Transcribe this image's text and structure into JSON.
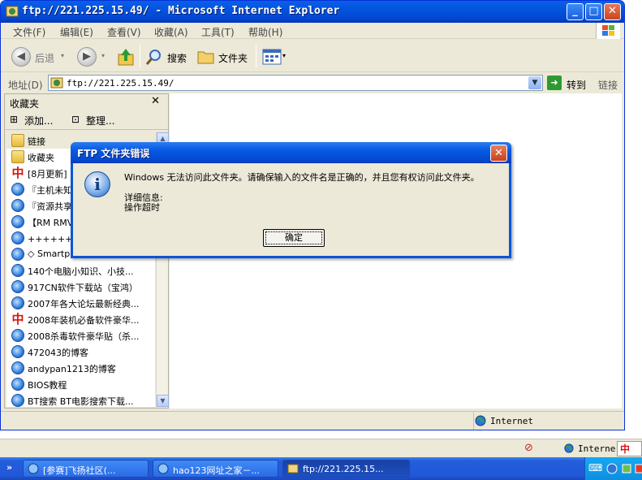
{
  "window": {
    "title": "ftp://221.225.15.49/ - Microsoft Internet Explorer",
    "controls": {
      "minimize": "_",
      "maximize": "□",
      "close": "✕"
    }
  },
  "menubar": {
    "items": [
      "文件(F)",
      "编辑(E)",
      "查看(V)",
      "收藏(A)",
      "工具(T)",
      "帮助(H)"
    ]
  },
  "toolbar": {
    "back_label": "后退",
    "search_label": "搜索",
    "folders_label": "文件夹"
  },
  "address": {
    "label": "地址(D)",
    "value": "ftp://221.225.15.49/",
    "go_label": "转到",
    "links_label": "链接"
  },
  "favorites": {
    "title": "收藏夹",
    "close": "✕",
    "add_label": "添加...",
    "organize_label": "整理...",
    "items": [
      {
        "label": "链接",
        "icon": "folder-icon"
      },
      {
        "label": "收藏夹",
        "icon": "folder-icon"
      },
      {
        "label": "[8月更新]",
        "icon": "china-logo-icon"
      },
      {
        "label": "『主机未知",
        "icon": "ie-page-icon"
      },
      {
        "label": "『资源共享",
        "icon": "ie-page-icon"
      },
      {
        "label": "【RM RMVB",
        "icon": "ie-page-icon"
      },
      {
        "label": "++++++【论",
        "icon": "ie-page-icon"
      },
      {
        "label": "◇ Smartpl",
        "icon": "ie-page-icon"
      },
      {
        "label": "140个电脑小知识、小技...",
        "icon": "ie-page-icon"
      },
      {
        "label": "917CN软件下载站（宝鸿）",
        "icon": "ie-page-icon"
      },
      {
        "label": "2007年各大论坛最新经典...",
        "icon": "ie-page-icon"
      },
      {
        "label": "2008年装机必备软件豪华...",
        "icon": "china-logo-icon"
      },
      {
        "label": "2008杀毒软件豪华贴（杀...",
        "icon": "ie-page-icon"
      },
      {
        "label": "472043的博客",
        "icon": "ie-page-icon"
      },
      {
        "label": "andypan1213的博客",
        "icon": "ie-page-icon"
      },
      {
        "label": "BIOS教程",
        "icon": "ie-page-icon"
      },
      {
        "label": "BT搜索 BT电影搜索下载...",
        "icon": "ie-page-icon"
      }
    ]
  },
  "status": {
    "zone": "Internet"
  },
  "dialog": {
    "title": "FTP 文件夹错误",
    "message": "Windows 无法访问此文件夹。请确保输入的文件名是正确的，并且您有权访问此文件夹。",
    "detail_label": "详细信息:",
    "detail_value": "操作超时",
    "ok_label": "确定",
    "close": "✕",
    "icon_glyph": "i"
  },
  "langbar": {
    "zone": "Interne",
    "ime": "中"
  },
  "taskbar": {
    "quick_launch": "»",
    "tasks": [
      {
        "label": "[参赛]飞扬社区(...",
        "active": false
      },
      {
        "label": "hao123网址之家－...",
        "active": false
      },
      {
        "label": "ftp://221.225.15...",
        "active": true
      }
    ]
  },
  "colors": {
    "titlebar": "#0356e0",
    "dialog_border": "#0b55d8",
    "taskbar": "#245edb",
    "window_bg": "#ece9d8"
  }
}
